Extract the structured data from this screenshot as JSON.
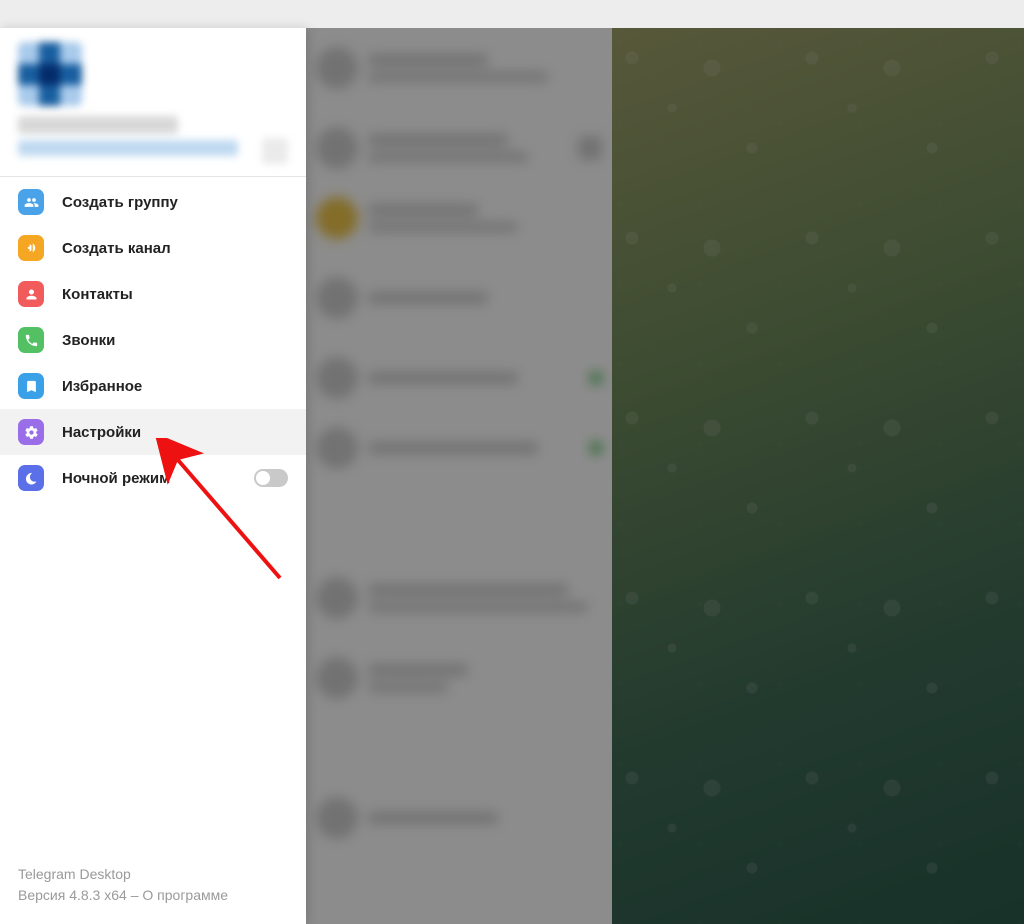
{
  "menu": {
    "create_group": "Создать группу",
    "create_channel": "Создать канал",
    "contacts": "Контакты",
    "calls": "Звонки",
    "saved": "Избранное",
    "settings": "Настройки",
    "night_mode": "Ночной режим"
  },
  "footer": {
    "app_name": "Telegram Desktop",
    "version_prefix": "Версия 4.8.3 x64",
    "sep": " – ",
    "about": "О программе"
  },
  "icons": {
    "group": "group-icon",
    "megaphone": "megaphone-icon",
    "person": "person-icon",
    "phone": "phone-icon",
    "bookmark": "bookmark-icon",
    "gear": "gear-icon",
    "moon": "moon-icon"
  },
  "night_mode_on": false
}
